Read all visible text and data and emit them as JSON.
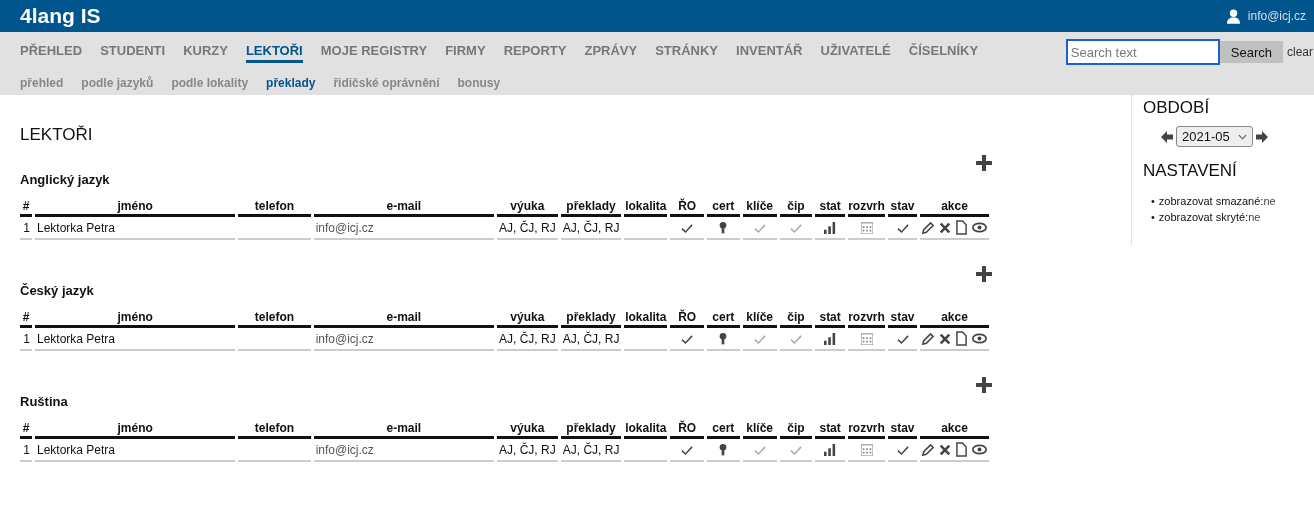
{
  "app": {
    "title": "4lang IS",
    "user": "info@icj.cz"
  },
  "nav": [
    {
      "label": "PŘEHLED",
      "selected": false
    },
    {
      "label": "STUDENTI",
      "selected": false
    },
    {
      "label": "KURZY",
      "selected": false
    },
    {
      "label": "LEKTOŘI",
      "selected": true
    },
    {
      "label": "MOJE REGISTRY",
      "selected": false
    },
    {
      "label": "FIRMY",
      "selected": false
    },
    {
      "label": "REPORTY",
      "selected": false
    },
    {
      "label": "ZPRÁVY",
      "selected": false
    },
    {
      "label": "STRÁNKY",
      "selected": false
    },
    {
      "label": "INVENTÁŘ",
      "selected": false
    },
    {
      "label": "UŽIVATELÉ",
      "selected": false
    },
    {
      "label": "ČÍSELNÍKY",
      "selected": false
    }
  ],
  "subnav": [
    {
      "label": "přehled",
      "selected": false
    },
    {
      "label": "podle jazyků",
      "selected": false
    },
    {
      "label": "podle lokality",
      "selected": false
    },
    {
      "label": "překlady",
      "selected": true
    },
    {
      "label": "řidičské oprávnění",
      "selected": false
    },
    {
      "label": "bonusy",
      "selected": false
    }
  ],
  "search": {
    "placeholder": "Search text",
    "button": "Search",
    "clear": "clear"
  },
  "page_title": "LEKTOŘI",
  "sections": [
    {
      "title": "Anglický jazyk",
      "columns": [
        "#",
        "jméno",
        "telefon",
        "e-mail",
        "výuka",
        "překlady",
        "lokalita",
        "ŘO",
        "cert",
        "klíče",
        "čip",
        "stat",
        "rozvrh",
        "stav",
        "akce"
      ],
      "rows": [
        {
          "index": "1",
          "name": "Lektorka Petra",
          "email": "info@icj.cz",
          "vyuka": "AJ, ČJ, RJ",
          "preklady": "AJ, ČJ, RJ",
          "ro": true,
          "klice": false,
          "cip": false,
          "stav": true
        }
      ]
    },
    {
      "title": "Český jazyk",
      "columns": [
        "#",
        "jméno",
        "telefon",
        "e-mail",
        "výuka",
        "překlady",
        "lokalita",
        "ŘO",
        "cert",
        "klíče",
        "čip",
        "stat",
        "rozvrh",
        "stav",
        "akce"
      ],
      "rows": [
        {
          "index": "1",
          "name": "Lektorka Petra",
          "email": "info@icj.cz",
          "vyuka": "AJ, ČJ, RJ",
          "preklady": "AJ, ČJ, RJ",
          "ro": true,
          "klice": false,
          "cip": false,
          "stav": true
        }
      ]
    },
    {
      "title": "Ruština",
      "columns": [
        "#",
        "jméno",
        "telefon",
        "e-mail",
        "výuka",
        "překlady",
        "lokalita",
        "ŘO",
        "cert",
        "klíče",
        "čip",
        "stat",
        "rozvrh",
        "stav",
        "akce"
      ],
      "rows": [
        {
          "index": "1",
          "name": "Lektorka Petra",
          "email": "info@icj.cz",
          "vyuka": "AJ, ČJ, RJ",
          "preklady": "AJ, ČJ, RJ",
          "ro": true,
          "klice": false,
          "cip": false,
          "stav": true
        }
      ]
    }
  ],
  "sidebar": {
    "period_title": "OBDOBÍ",
    "period": "2021-05",
    "settings_title": "NASTAVENÍ",
    "settings": [
      {
        "bullet": "•",
        "label": "zobrazovat smazané:",
        "value": "ne"
      },
      {
        "bullet": "•",
        "label": "zobrazovat skryté:",
        "value": "ne"
      }
    ]
  }
}
